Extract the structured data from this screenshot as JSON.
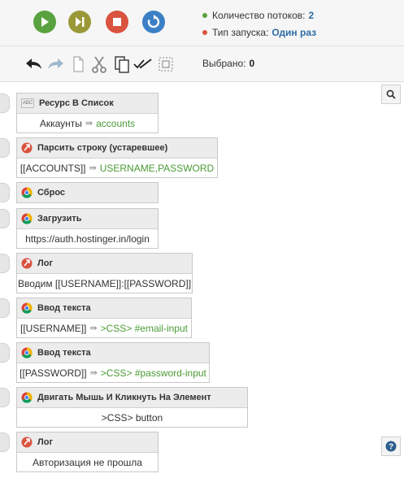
{
  "header": {
    "threads_label": "Количество потоков:",
    "threads_value": "2",
    "launch_label": "Тип запуска:",
    "launch_value": "Один раз"
  },
  "toolbar": {
    "selected_label": "Выбрано:",
    "selected_value": "0"
  },
  "blocks": [
    {
      "title": "Ресурс В Список",
      "icon": "abc-icon",
      "body_a": "Аккаунты",
      "body_b": "accounts"
    },
    {
      "title": "Парсить строку (устаревшее)",
      "icon": "parse-icon",
      "body_a": "[[ACCOUNTS]]",
      "body_b": "USERNAME,PASSWORD"
    },
    {
      "title": "Сброс",
      "icon": "chrome-icon"
    },
    {
      "title": "Загрузить",
      "icon": "chrome-icon",
      "body": "https://auth.hostinger.in/login"
    },
    {
      "title": "Лог",
      "icon": "log-icon",
      "body": "Вводим [[USERNAME]]:[[PASSWORD]]"
    },
    {
      "title": "Ввод текста",
      "icon": "chrome-icon",
      "body_a": "[[USERNAME]]",
      "body_b": ">CSS> #email-input"
    },
    {
      "title": "Ввод текста",
      "icon": "chrome-icon",
      "body_a": "[[PASSWORD]]",
      "body_b": ">CSS> #password-input"
    },
    {
      "title": "Двигать Мышь И Кликнуть На Элемент",
      "icon": "chrome-icon",
      "body": ">CSS> button"
    },
    {
      "title": "Лог",
      "icon": "log-icon",
      "body": "Авторизация не прошла"
    }
  ],
  "colors": {
    "play": "#5aa240",
    "next": "#9b9838",
    "stop": "#d9533f",
    "restart": "#3b80c5",
    "value_blue": "#2e6da4",
    "value_green": "#4a9b35"
  }
}
